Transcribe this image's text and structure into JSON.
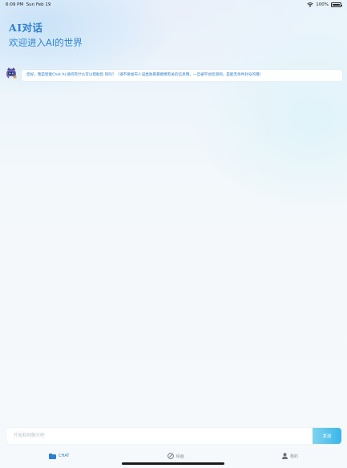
{
  "status_bar": {
    "time": "6:09 PM",
    "date": "Sun Feb 19",
    "battery": "100%"
  },
  "header": {
    "title": "AI对话",
    "subtitle": "欢迎进入AI的世界"
  },
  "messages": [
    {
      "sender": "bot",
      "avatar_icon": "robot-avatar-icon",
      "text": "您好，我是智能Chat AI,请问有什么可以帮助您 的吗？（请不要发布人设类防黄暴擦擦有关的信息哦，一旦被平台检测到，是能无条件封号的哦）"
    }
  ],
  "composer": {
    "placeholder": "开始和他聊天吧",
    "send_label": "发送"
  },
  "tabs": [
    {
      "label": "CHAT",
      "icon": "chat-folder-icon",
      "active": true
    },
    {
      "label": "绘画",
      "icon": "paint-icon",
      "active": false
    },
    {
      "label": "我的",
      "icon": "user-icon",
      "active": false
    }
  ],
  "colors": {
    "accent": "#2f7fd0",
    "send_button_start": "#7fd3ef",
    "send_button_end": "#39b6ea",
    "tab_inactive": "#8a9199"
  }
}
